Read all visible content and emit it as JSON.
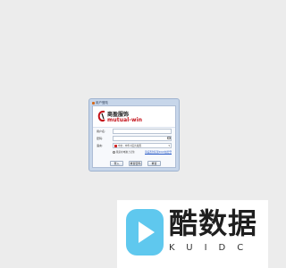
{
  "dialog": {
    "title": "用户登陆",
    "logo": {
      "cn": "商盈服饰",
      "en": "mutual-win"
    },
    "form": {
      "username": {
        "label": "用户名:",
        "value": ""
      },
      "password": {
        "label": "密码:",
        "value": ""
      },
      "language": {
        "label": "语言:",
        "value": "中文 - 中华人民共和国"
      },
      "remember_label": "我是在电脑上记住",
      "link_text": "请设置到实现2024加密登"
    },
    "buttons": {
      "login": "登入",
      "reset": "重置密码",
      "clear": "重置"
    }
  },
  "watermark": {
    "cn": "酷数据",
    "en": "KUIDC"
  },
  "colors": {
    "dialog_frame": "#c7d6ea",
    "logo_red": "#c4121a",
    "link_blue": "#2457c5",
    "watermark_accent": "#4fc3ea",
    "page_bg": "#ececec"
  }
}
